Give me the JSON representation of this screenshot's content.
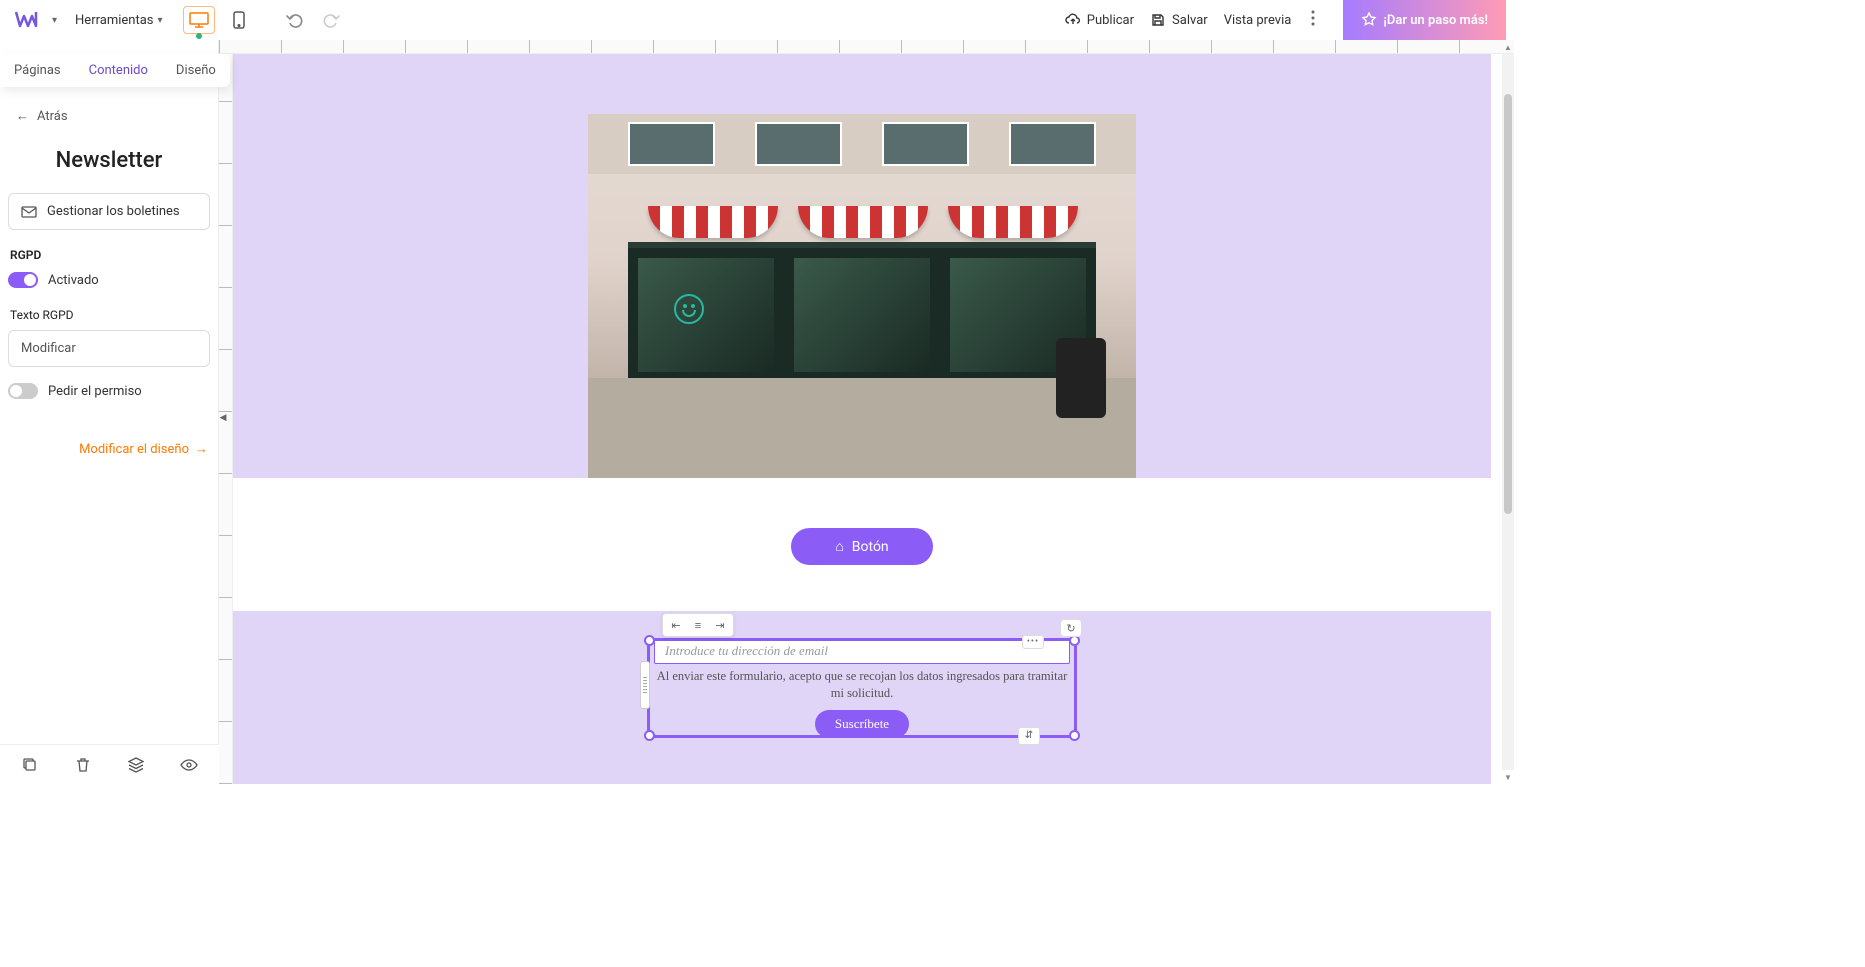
{
  "topbar": {
    "tools_label": "Herramientas",
    "publish": "Publicar",
    "save": "Salvar",
    "preview": "Vista previa",
    "cta": "¡Dar un paso más!"
  },
  "tabs": {
    "pages": "Páginas",
    "content": "Contenido",
    "design": "Diseño"
  },
  "panel": {
    "back": "Atrás",
    "title": "Newsletter",
    "manage": "Gestionar los boletines",
    "rgpd_label": "RGPD",
    "rgpd_toggle": "Activado",
    "rgpd_text_label": "Texto RGPD",
    "modify": "Modificar",
    "permission_toggle": "Pedir el permiso",
    "modify_design": "Modificar el diseño"
  },
  "canvas": {
    "button_label": "Botón",
    "email_placeholder": "Introduce tu dirección de email",
    "consent_text": "Al enviar este formulario, acepto que se recojan los datos ingresados para tramitar mi solicitud.",
    "subscribe": "Suscríbete"
  }
}
